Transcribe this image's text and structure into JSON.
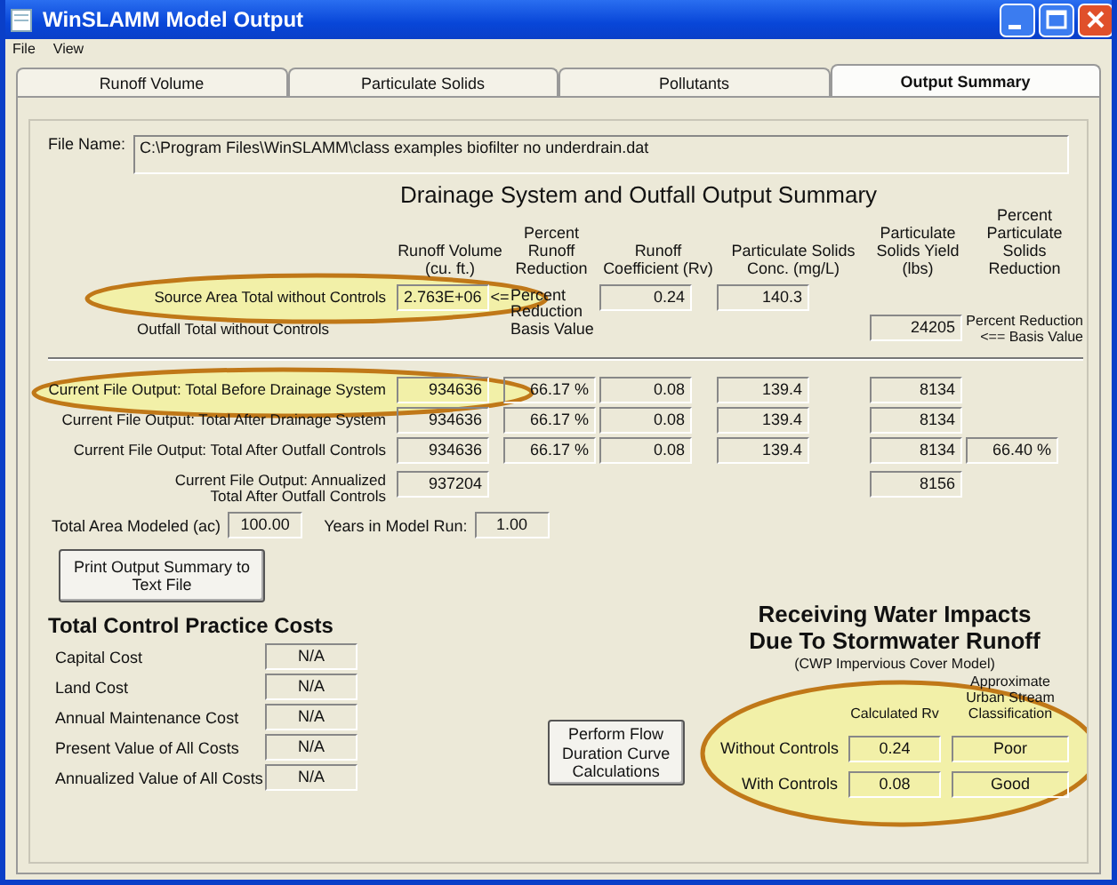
{
  "window": {
    "title": "WinSLAMM Model Output"
  },
  "menu": [
    "File",
    "View"
  ],
  "tabs": [
    {
      "label": "Runoff Volume",
      "selected": false
    },
    {
      "label": "Particulate Solids",
      "selected": false
    },
    {
      "label": "Pollutants",
      "selected": false
    },
    {
      "label": "Output Summary",
      "selected": true
    }
  ],
  "file_name": {
    "label": "File Name:",
    "value": "C:\\Program Files\\WinSLAMM\\class examples biofilter no underdrain.dat"
  },
  "summary": {
    "heading": "Drainage System and Outfall Output Summary",
    "columns": [
      "Runoff Volume (cu. ft.)",
      "Percent Runoff Reduction",
      "Runoff Coefficient (Rv)",
      "Particulate Solids Conc. (mg/L)",
      "Particulate Solids Yield (lbs)",
      "Percent Particulate Solids Reduction"
    ],
    "rows": [
      {
        "kind": "source",
        "label": "Source Area Total without Controls",
        "values": [
          "2.763E+06",
          "0.24",
          "140.3"
        ],
        "arrow": "<=",
        "note": "Percent Reduction Basis Value"
      },
      {
        "kind": "outfall",
        "label": "Outfall Total without Controls",
        "values": [
          "24205"
        ],
        "note_above": "Percent Reduction",
        "note": "<== Basis Value"
      },
      {
        "kind": "separator"
      },
      {
        "kind": "result",
        "label": "Current File Output:  Total Before Drainage System",
        "values": [
          "934636",
          "66.17 %",
          "0.08",
          "139.4",
          "8134"
        ]
      },
      {
        "kind": "result",
        "label": "Current File Output:  Total After Drainage System",
        "values": [
          "934636",
          "66.17 %",
          "0.08",
          "139.4",
          "8134"
        ]
      },
      {
        "kind": "result",
        "label": "Current File Output:  Total After Outfall Controls",
        "values": [
          "934636",
          "66.17 %",
          "0.08",
          "139.4",
          "8134",
          "66.40 %"
        ]
      },
      {
        "kind": "annualized",
        "label": "Current File Output:  Annualized",
        "label_2": "Total After Outfall Controls",
        "values": [
          "937204",
          "8156"
        ]
      }
    ]
  },
  "model": [
    {
      "label": "Total Area Modeled (ac)",
      "value": "100.00"
    },
    {
      "label": "Years in Model Run:",
      "value": "1.00"
    }
  ],
  "print_button": "Print Output Summary to Text File",
  "costs": {
    "heading": "Total Control Practice Costs",
    "rows": [
      {
        "label": "Capital Cost",
        "value": "N/A"
      },
      {
        "label": "Land Cost",
        "value": "N/A"
      },
      {
        "label": "Annual Maintenance Cost",
        "value": "N/A"
      },
      {
        "label": "Present Value of All Costs",
        "value": "N/A"
      },
      {
        "label": "Annualized Value of All Costs",
        "value": "N/A"
      }
    ]
  },
  "flow_button": "Perform Flow Duration Curve Calculations",
  "receiving": {
    "heading": "Receiving Water Impacts Due To Stormwater Runoff",
    "subtitle": "(CWP Impervious Cover Model)",
    "columns": [
      "Calculated Rv",
      "Approximate Urban Stream Classification"
    ],
    "rows": [
      {
        "label": "Without Controls",
        "rv": "0.24",
        "classification": "Poor"
      },
      {
        "label": "With Controls",
        "rv": "0.08",
        "classification": "Good"
      }
    ]
  }
}
